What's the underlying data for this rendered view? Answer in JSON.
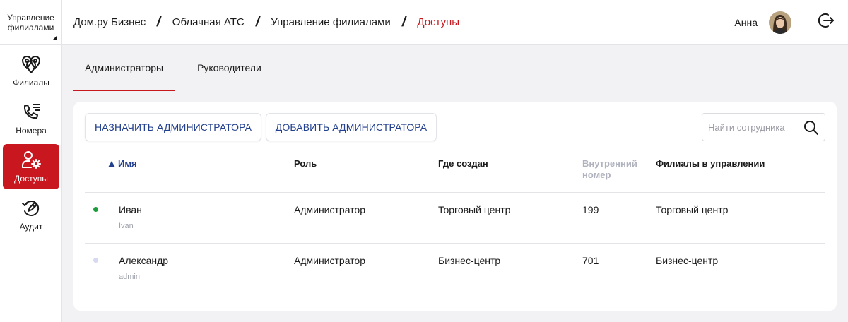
{
  "sidebar": {
    "app_switch_label": "Управление филиалами",
    "items": [
      {
        "label": "Филиалы",
        "icon": "branches-pin-icon",
        "active": false
      },
      {
        "label": "Номера",
        "icon": "phone-list-icon",
        "active": false
      },
      {
        "label": "Доступы",
        "icon": "user-gear-icon",
        "active": true
      },
      {
        "label": "Аудит",
        "icon": "audit-history-icon",
        "active": false
      }
    ]
  },
  "header": {
    "breadcrumbs": [
      "Дом.ру Бизнес",
      "Облачная АТС",
      "Управление филиалами",
      "Доступы"
    ],
    "user_name": "Анна",
    "logout_icon": "logout-icon"
  },
  "tabs": [
    {
      "label": "Администраторы",
      "active": true
    },
    {
      "label": "Руководители",
      "active": false
    }
  ],
  "toolbar": {
    "assign_label": "НАЗНАЧИТЬ АДМИНИСТРАТОРА",
    "add_label": "ДОБАВИТЬ АДМИНИСТРАТОРА",
    "search_placeholder": "Найти сотрудника"
  },
  "table": {
    "columns": [
      "Имя",
      "Роль",
      "Где создан",
      "Внутренний номер",
      "Филиалы в управлении"
    ],
    "sorted_column": "Имя",
    "rows": [
      {
        "name": "Иван",
        "login": "Ivan",
        "role": "Администратор",
        "created": "Торговый центр",
        "ext": "199",
        "branches": "Торговый центр",
        "status_color": "#1a9e3a"
      },
      {
        "name": "Александр",
        "login": "admin",
        "role": "Администратор",
        "created": "Бизнес-центр",
        "ext": "701",
        "branches": "Бизнес-центр",
        "status_color": "#d6d9ef"
      }
    ]
  },
  "colors": {
    "accent": "#c8171e",
    "link": "#23408e"
  }
}
